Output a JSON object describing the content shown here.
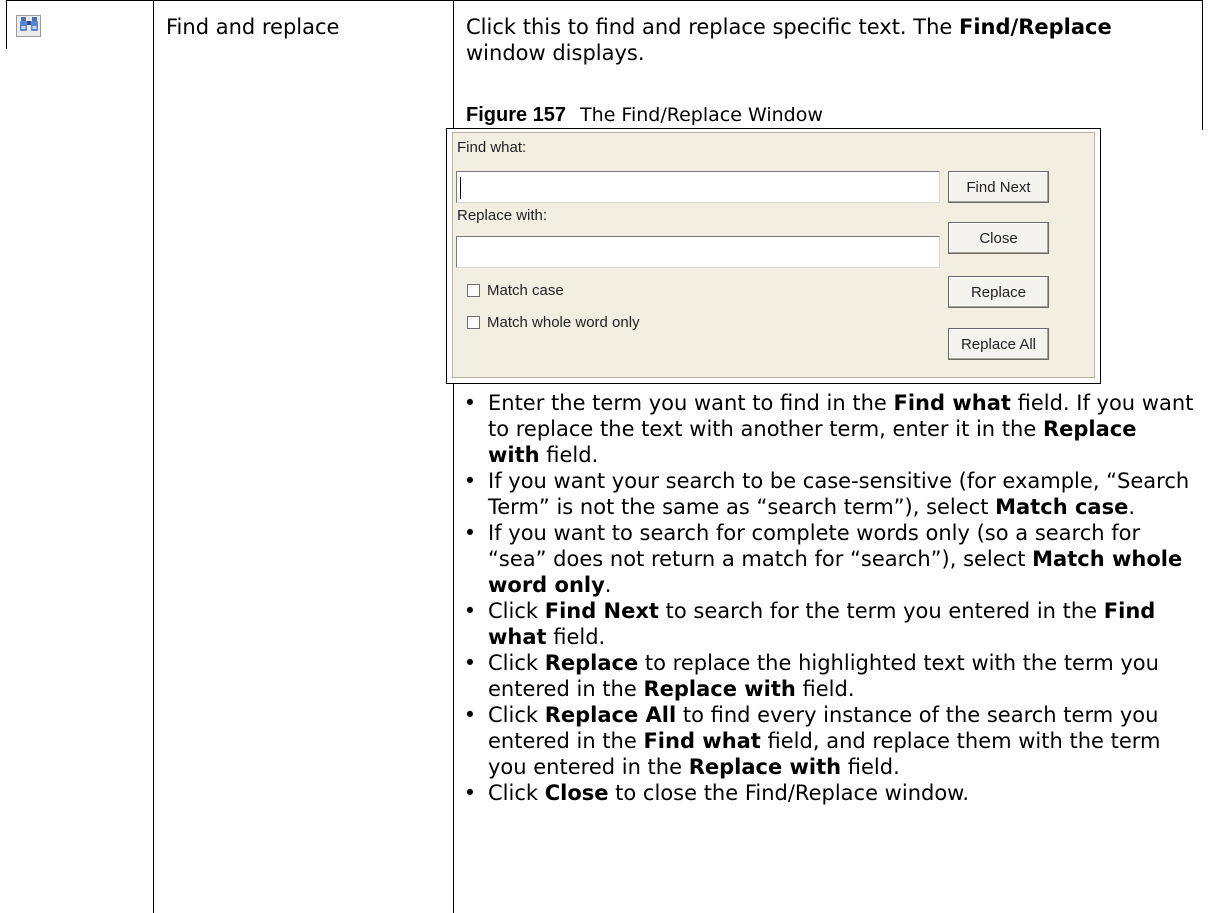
{
  "feature": {
    "icon": "binoculars-icon",
    "name": "Find and replace",
    "description": {
      "part1": "Click this to find and replace specific text. The ",
      "bold1": "Find/Replace",
      "part2": " window displays."
    }
  },
  "figure": {
    "number": "Figure 157",
    "title": "The Find/Replace Window"
  },
  "dialog": {
    "find_label": "Find what:",
    "find_value": "",
    "replace_label": "Replace with:",
    "replace_value": "",
    "match_case_label": "Match case",
    "match_case_checked": false,
    "whole_word_label": "Match whole word only",
    "whole_word_checked": false,
    "find_next_button": "Find Next",
    "close_button": "Close",
    "replace_button": "Replace",
    "replace_all_button": "Replace All"
  },
  "bullets": [
    [
      {
        "t": "Enter the term you want to find in the "
      },
      {
        "t": "Find what",
        "b": true
      },
      {
        "t": " field. If you want to replace the text with another term, enter it in the "
      },
      {
        "t": "Replace with",
        "b": true
      },
      {
        "t": " field."
      }
    ],
    [
      {
        "t": "If you want your search to be case-sensitive (for example, “Search Term” is not the same as “search term”), select "
      },
      {
        "t": "Match case",
        "b": true
      },
      {
        "t": "."
      }
    ],
    [
      {
        "t": "If you want to search for complete words only (so a search for “sea” does not return a match for “search”), select "
      },
      {
        "t": "Match whole word only",
        "b": true
      },
      {
        "t": "."
      }
    ],
    [
      {
        "t": "Click "
      },
      {
        "t": "Find Next",
        "b": true
      },
      {
        "t": " to search for the term you entered in the "
      },
      {
        "t": "Find what",
        "b": true
      },
      {
        "t": " field."
      }
    ],
    [
      {
        "t": "Click "
      },
      {
        "t": "Replace",
        "b": true
      },
      {
        "t": " to replace the highlighted text with the term you entered in the "
      },
      {
        "t": "Replace with",
        "b": true
      },
      {
        "t": " field."
      }
    ],
    [
      {
        "t": "Click "
      },
      {
        "t": "Replace All",
        "b": true
      },
      {
        "t": " to find every instance of the search term you entered in the "
      },
      {
        "t": "Find what",
        "b": true
      },
      {
        "t": " field, and replace them with the term you entered in the "
      },
      {
        "t": "Replace with",
        "b": true
      },
      {
        "t": " field."
      }
    ],
    [
      {
        "t": "Click "
      },
      {
        "t": "Close",
        "b": true
      },
      {
        "t": " to close the Find/Replace window."
      }
    ]
  ]
}
